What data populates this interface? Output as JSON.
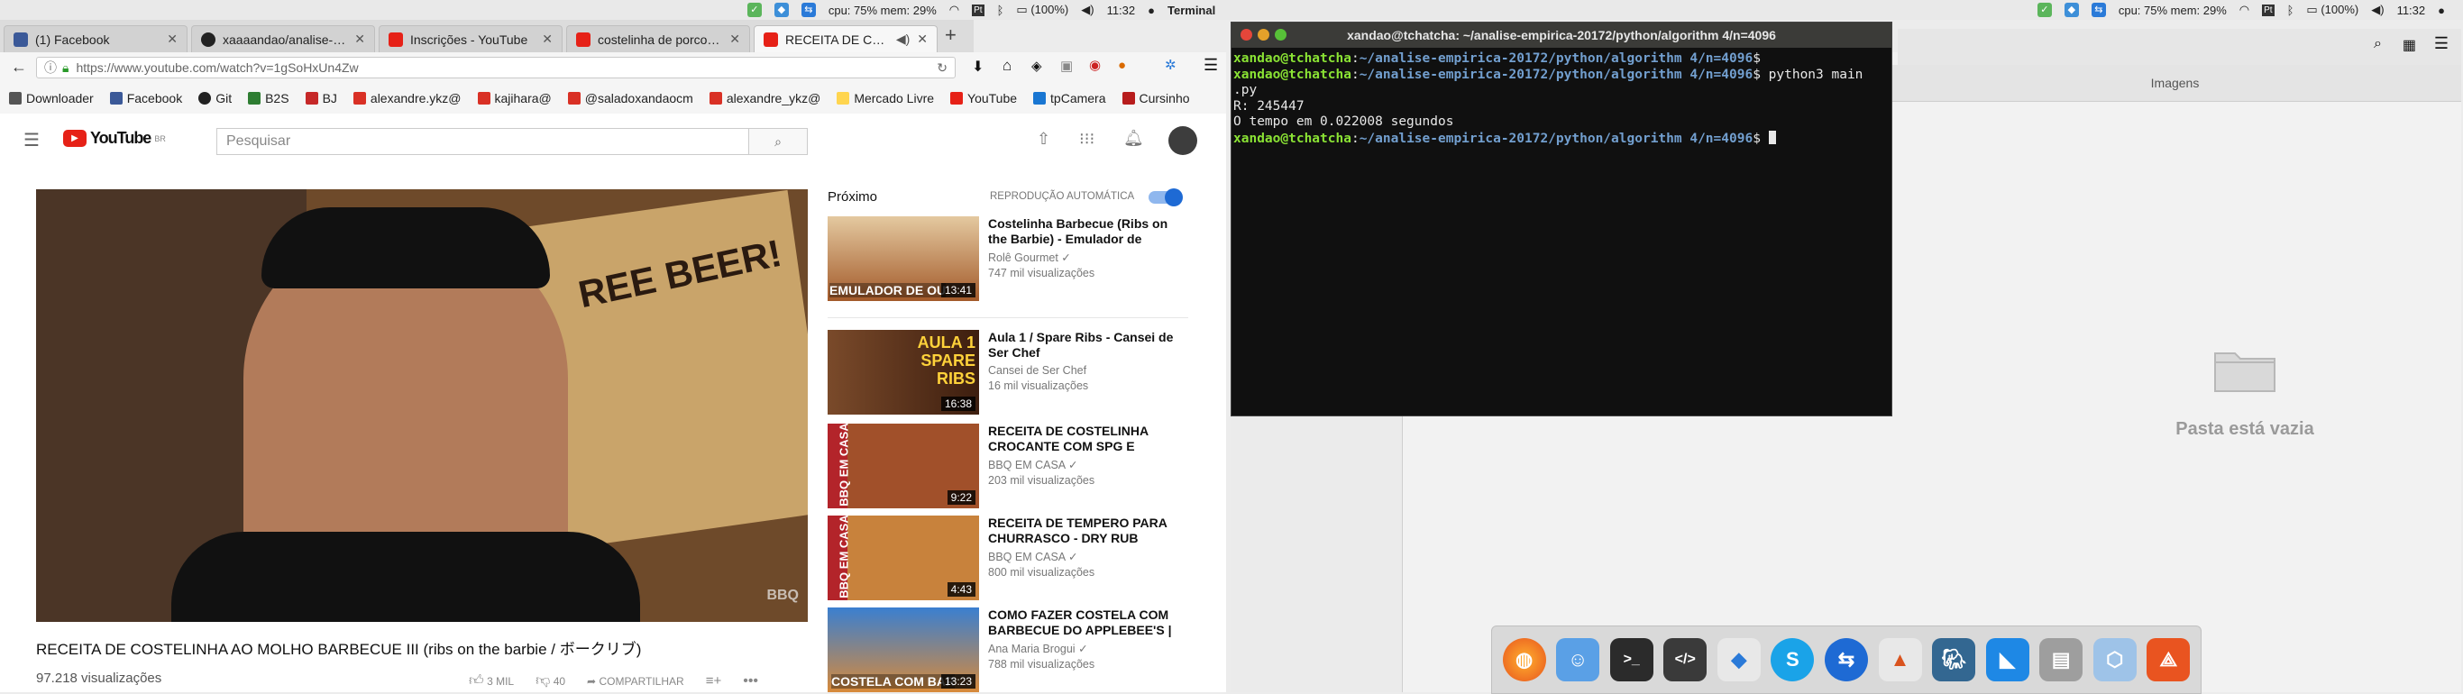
{
  "panel_left": {
    "cpu_mem": "cpu: 75% mem: 29%",
    "battery": "(100%)",
    "clock": "11:32",
    "app_name": "Terminal"
  },
  "panel_right": {
    "cpu_mem": "cpu: 75% mem: 29%",
    "battery": "(100%)",
    "clock": "11:32"
  },
  "tabs": [
    {
      "label": "(1) Facebook",
      "color": "#3b5998"
    },
    {
      "label": "xaaaandao/analise-em",
      "color": "#222"
    },
    {
      "label": "Inscrições - YouTube",
      "color": "#e62117"
    },
    {
      "label": "costelinha de porco ao",
      "color": "#e62117"
    },
    {
      "label": "RECEITA DE COSTEL",
      "color": "#e62117"
    }
  ],
  "url": "https://www.youtube.com/watch?v=1gSoHxUn4Zw",
  "bookmarks": [
    "Downloader",
    "Facebook",
    "Git",
    "B2S",
    "BJ",
    "alexandre.ykz@",
    "kajihara@",
    "@saladoxandaocm",
    "alexandre_ykz@",
    "Mercado Livre",
    "YouTube",
    "tpCamera",
    "Cursinho"
  ],
  "youtube": {
    "logo": "YouTube",
    "logo_sup": "BR",
    "search_placeholder": "Pesquisar",
    "video_title": "RECEITA DE COSTELINHA AO MOLHO BARBECUE III (ribs on the barbie / ボークリブ)",
    "views": "97.218 visualizações",
    "likes": "3 MIL",
    "dislikes": "40",
    "share": "COMPARTILHAR",
    "next_label": "Próximo",
    "autoplay_label": "REPRODUÇÃO AUTOMÁTICA",
    "player_text": "REE BEER!",
    "player_watermark": "BBQ",
    "cards": [
      {
        "title": "Costelinha Barbecue (Ribs on the Barbie) - Emulador de",
        "channel": "Rolê Gourmet",
        "views": "747 mil visualizações",
        "duration": "13:41",
        "thumb": "EMULADOR DE OU"
      },
      {
        "title": "Aula 1 / Spare Ribs - Cansei de Ser Chef",
        "channel": "Cansei de Ser Chef",
        "views": "16 mil visualizações",
        "duration": "16:38",
        "thumb": "AULA 1 SPARE RIBS"
      },
      {
        "title": "RECEITA DE COSTELINHA CROCANTE COM SPG E LIMÃO",
        "channel": "BBQ EM CASA",
        "views": "203 mil visualizações",
        "duration": "9:22",
        "thumb": "BBQ EM CASA"
      },
      {
        "title": "RECEITA DE TEMPERO PARA CHURRASCO - DRY RUB",
        "channel": "BBQ EM CASA",
        "views": "800 mil visualizações",
        "duration": "4:43",
        "thumb": "BBQ EM CASA"
      },
      {
        "title": "COMO FAZER COSTELA COM BARBECUE DO APPLEBEE'S |",
        "channel": "Ana Maria Brogui",
        "views": "788 mil visualizações",
        "duration": "13:23",
        "thumb": "COSTELA COM BAR"
      }
    ]
  },
  "terminal": {
    "title": "xandao@tchatcha: ~/analise-empirica-20172/python/algorithm 4/n=4096",
    "user": "xandao@tchatcha",
    "path": "~/analise-empirica-20172/python/algorithm 4/n=4096",
    "command": " python3 main",
    "command_wrap": ".py",
    "out1": "R: 245447",
    "out2": "O tempo em 0.022008 segundos"
  },
  "file_manager": {
    "tab_label": "Imagens",
    "empty_text": "Pasta está vazia"
  },
  "dock_icons": [
    "firefox-icon",
    "finder-icon",
    "terminal-icon",
    "code-editor-icon",
    "dropbox-icon",
    "skype-icon",
    "teamviewer-icon",
    "matlab-icon",
    "postgres-icon",
    "mysql-workbench-icon",
    "disk-icon",
    "virtualbox-icon",
    "ubuntu-software-icon"
  ]
}
